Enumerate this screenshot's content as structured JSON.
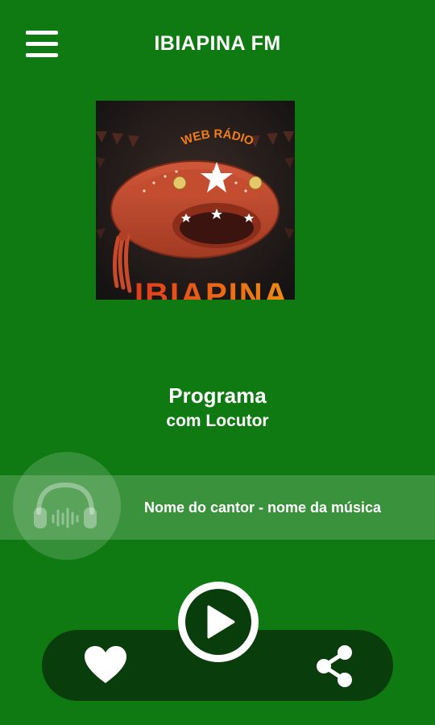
{
  "header": {
    "title": "IBIAPINA FM",
    "menu_icon": "hamburger-menu-icon"
  },
  "cover": {
    "top_text": "WEB RÁDIO",
    "logo_text": "IBIAPINA FM"
  },
  "program": {
    "title": "Programa",
    "host": "com Locutor"
  },
  "now_playing": {
    "icon": "headphones-icon",
    "text": "Nome do cantor - nome da música"
  },
  "controls": {
    "favorite_icon": "heart-icon",
    "play_icon": "play-icon",
    "share_icon": "share-icon"
  },
  "colors": {
    "background": "#0f7a12",
    "bottom_bar": "#0a3d0c",
    "text": "#ffffff"
  }
}
